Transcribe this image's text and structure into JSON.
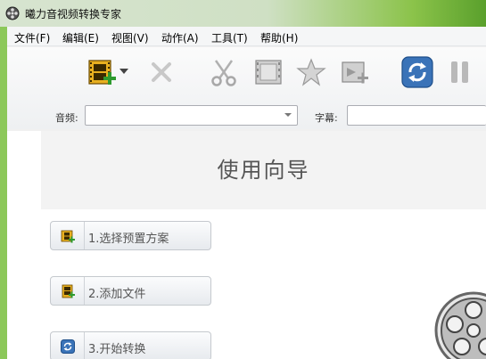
{
  "window": {
    "title": "曦力音视频转换专家"
  },
  "menu": [
    {
      "label": "文件(F)"
    },
    {
      "label": "编辑(E)"
    },
    {
      "label": "视图(V)"
    },
    {
      "label": "动作(A)"
    },
    {
      "label": "工具(T)"
    },
    {
      "label": "帮助(H)"
    }
  ],
  "toolbar": {
    "buttons": [
      "add-video-icon",
      "dropdown-arrow-icon",
      "delete-icon",
      "cut-icon",
      "film-clip-icon",
      "effects-star-icon",
      "merge-add-icon",
      "convert-icon",
      "pause-icon"
    ]
  },
  "audio": {
    "label": "音频:",
    "value": ""
  },
  "subtitle": {
    "label": "字幕:",
    "value": ""
  },
  "guide": {
    "title": "使用向导",
    "steps": [
      {
        "label": "1.选择预置方案",
        "icon": "film-add-icon"
      },
      {
        "label": "2.添加文件",
        "icon": "file-add-icon"
      },
      {
        "label": "3.开始转换",
        "icon": "convert-icon"
      }
    ]
  },
  "colors": {
    "accent": "#3a73b8",
    "title_gradient_end": "#5aa02c"
  }
}
